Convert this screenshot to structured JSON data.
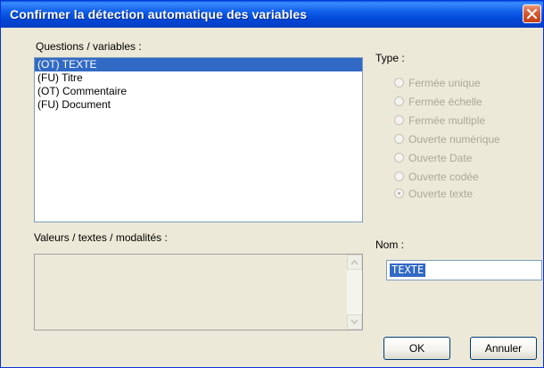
{
  "dialog": {
    "title": "Confirmer la détection automatique des variables"
  },
  "questions": {
    "label": "Questions / variables :",
    "items": [
      {
        "label": "(OT) TEXTE",
        "selected": true
      },
      {
        "label": "(FU) Titre",
        "selected": false
      },
      {
        "label": "(OT) Commentaire",
        "selected": false
      },
      {
        "label": "(FU) Document",
        "selected": false
      }
    ]
  },
  "values": {
    "label": "Valeurs / textes / modalités :",
    "content": ""
  },
  "type": {
    "label": "Type :",
    "options": [
      {
        "label": "Fermée unique",
        "checked": false
      },
      {
        "label": "Fermée échelle",
        "checked": false
      },
      {
        "label": "Fermée multiple",
        "checked": false
      },
      {
        "label": "Ouverte numérique",
        "checked": false
      },
      {
        "label": "Ouverte Date",
        "checked": false
      },
      {
        "label": "Ouverte codée",
        "checked": false
      },
      {
        "label": "Ouverte texte",
        "checked": true
      }
    ]
  },
  "nom": {
    "label": "Nom :",
    "value": "TEXTE"
  },
  "buttons": {
    "ok": "OK",
    "cancel": "Annuler"
  }
}
